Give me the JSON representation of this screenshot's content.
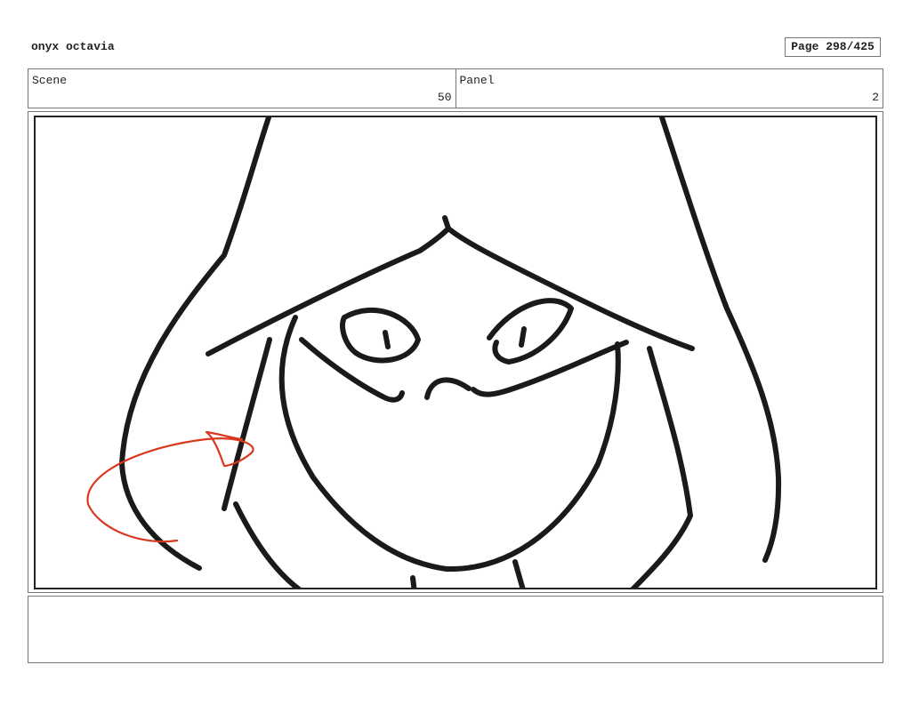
{
  "header": {
    "project_title": "onyx octavia",
    "page_label": "Page 298/425"
  },
  "scene": {
    "label": "Scene",
    "value": "50"
  },
  "panel": {
    "label": "Panel",
    "value": "2"
  },
  "drawing": {
    "line_color": "#1a1a1a",
    "annotation_color": "#d9381e"
  },
  "notes": {
    "text": ""
  }
}
